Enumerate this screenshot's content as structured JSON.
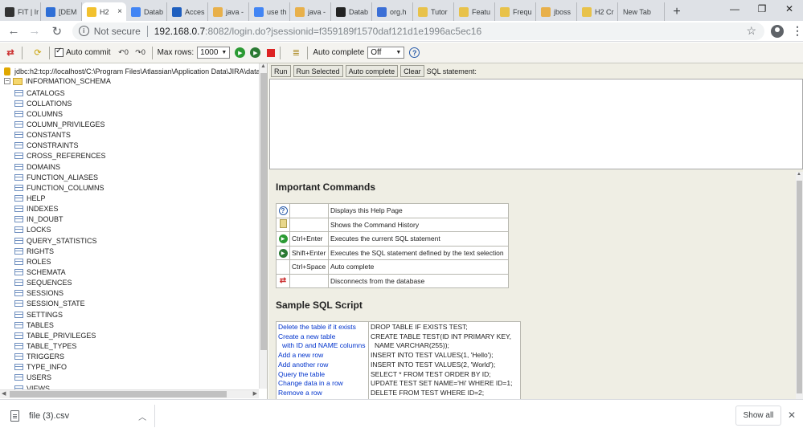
{
  "browser": {
    "tabs": [
      {
        "title": "FIT | Ir",
        "color": "#333333",
        "icon": "gear-icon"
      },
      {
        "title": "[DEM",
        "color": "#2f6fd6",
        "icon": "diamond-icon"
      },
      {
        "title": "H2",
        "color": "#f2c12e",
        "icon": "h2-icon",
        "active": true
      },
      {
        "title": "Datab",
        "color": "#4285f4",
        "icon": "google-icon"
      },
      {
        "title": "Acces",
        "color": "#1f5fbf",
        "icon": "atlassian-icon"
      },
      {
        "title": "java -",
        "color": "#e8b04a",
        "icon": "java-icon"
      },
      {
        "title": "use th",
        "color": "#4285f4",
        "icon": "google-icon"
      },
      {
        "title": "java -",
        "color": "#e8b04a",
        "icon": "java-icon"
      },
      {
        "title": "Datab",
        "color": "#222222",
        "icon": "medium-icon"
      },
      {
        "title": "org.h",
        "color": "#3b6fd6",
        "icon": "chat-icon"
      },
      {
        "title": "Tutor",
        "color": "#e8c24a",
        "icon": "h2-icon"
      },
      {
        "title": "Featu",
        "color": "#e8c24a",
        "icon": "h2-icon"
      },
      {
        "title": "Frequ",
        "color": "#e8c24a",
        "icon": "h2-icon"
      },
      {
        "title": "jboss",
        "color": "#e8b04a",
        "icon": "java-icon"
      },
      {
        "title": "H2 Cr",
        "color": "#e8c24a",
        "icon": "h2-icon"
      }
    ],
    "new_tab_title": "New Tab",
    "new_tab_button": "+",
    "window_controls": {
      "minimize": "—",
      "restore": "❐",
      "close": "✕"
    },
    "nav": {
      "back": "←",
      "forward": "→",
      "reload": "↻"
    },
    "security_label": "Not secure",
    "url_host": "192.168.0.7",
    "url_path": ":8082/login.do?jsessionid=f359189f1570daf121d1e1996ac5ec16",
    "bookmark_star": "☆",
    "menu_glyph": "⋮"
  },
  "toolbar": {
    "auto_commit_label": "Auto commit",
    "max_rows_label": "Max rows:",
    "max_rows_value": "1000",
    "auto_complete_label": "Auto complete",
    "auto_complete_value": "Off"
  },
  "tree": {
    "connection": "jdbc:h2:tcp://localhost/C:\\Program Files\\Atlassian\\Application Data\\JIRA\\datab",
    "schema": "INFORMATION_SCHEMA",
    "tables": [
      "CATALOGS",
      "COLLATIONS",
      "COLUMNS",
      "COLUMN_PRIVILEGES",
      "CONSTANTS",
      "CONSTRAINTS",
      "CROSS_REFERENCES",
      "DOMAINS",
      "FUNCTION_ALIASES",
      "FUNCTION_COLUMNS",
      "HELP",
      "INDEXES",
      "IN_DOUBT",
      "LOCKS",
      "QUERY_STATISTICS",
      "RIGHTS",
      "ROLES",
      "SCHEMATA",
      "SEQUENCES",
      "SESSIONS",
      "SESSION_STATE",
      "SETTINGS",
      "TABLES",
      "TABLE_PRIVILEGES",
      "TABLE_TYPES",
      "TRIGGERS",
      "TYPE_INFO",
      "USERS",
      "VIEWS"
    ]
  },
  "query": {
    "run": "Run",
    "run_selected": "Run Selected",
    "auto_complete": "Auto complete",
    "clear": "Clear",
    "sql_label": "SQL statement:"
  },
  "help": {
    "important_title": "Important Commands",
    "commands": [
      {
        "icon": "help-icon",
        "key": "",
        "desc": "Displays this Help Page"
      },
      {
        "icon": "history-icon",
        "key": "",
        "desc": "Shows the Command History"
      },
      {
        "icon": "run-icon",
        "key": "Ctrl+Enter",
        "desc": "Executes the current SQL statement"
      },
      {
        "icon": "run-selected-icon",
        "key": "Shift+Enter",
        "desc": "Executes the SQL statement defined by the text selection"
      },
      {
        "icon": "",
        "key": "Ctrl+Space",
        "desc": "Auto complete"
      },
      {
        "icon": "disconnect-icon",
        "key": "",
        "desc": "Disconnects from the database"
      }
    ],
    "sample_title": "Sample SQL Script",
    "sample_links": [
      "Delete the table if it exists",
      "Create a new table",
      "with ID and NAME columns",
      "Add a new row",
      "Add another row",
      "Query the table",
      "Change data in a row",
      "Remove a row"
    ],
    "sample_code": [
      "DROP TABLE IF EXISTS TEST;",
      "CREATE TABLE TEST(ID INT PRIMARY KEY,",
      "NAME VARCHAR(255));",
      "INSERT INTO TEST VALUES(1, 'Hello');",
      "INSERT INTO TEST VALUES(2, 'World');",
      "SELECT * FROM TEST ORDER BY ID;",
      "UPDATE TEST SET NAME='Hi' WHERE ID=1;",
      "DELETE FROM TEST WHERE ID=2;"
    ]
  },
  "downloads": {
    "file_name": "file (3).csv",
    "show_all": "Show all",
    "close": "✕"
  }
}
